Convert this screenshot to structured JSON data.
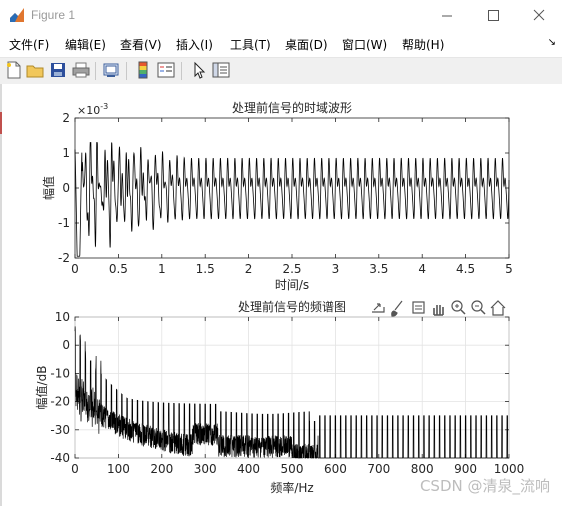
{
  "window": {
    "title": "Figure 1",
    "buttons": [
      "minimize",
      "maximize",
      "close"
    ]
  },
  "menu": {
    "items": [
      "文件(F)",
      "编辑(E)",
      "查看(V)",
      "插入(I)",
      "工具(T)",
      "桌面(D)",
      "窗口(W)",
      "帮助(H)"
    ],
    "expand": "↘"
  },
  "toolbar": {
    "icons": [
      "new-figure-icon",
      "open-file-icon",
      "save-icon",
      "print-icon",
      "link-plot-icon",
      "insert-colorbar-icon",
      "insert-legend-icon",
      "edit-plot-icon",
      "property-inspector-icon"
    ]
  },
  "axes_toolbar": {
    "icons": [
      "export-icon",
      "brush-icon",
      "data-tips-icon",
      "pan-icon",
      "zoom-in-icon",
      "zoom-out-icon",
      "home-icon"
    ]
  },
  "watermark": "CSDN @清泉_流响",
  "chart_data": [
    {
      "type": "line",
      "title": "处理前信号的时域波形",
      "xlabel": "时间/s",
      "ylabel": "幅值",
      "xlim": [
        0,
        5
      ],
      "ylim": [
        -2,
        2
      ],
      "exponent_label": "×10",
      "exponent_power": "-3",
      "xticks": [
        "0",
        "0.5",
        "1",
        "1.5",
        "2",
        "2.5",
        "3",
        "3.5",
        "4",
        "4.5",
        "5"
      ],
      "yticks": [
        "2",
        "1",
        "0",
        "-1",
        "-2"
      ],
      "grid": false,
      "series": [
        {
          "description_of_shape": null,
          "oscillation_cycles": 60,
          "steady_amplitude": 1.0
        }
      ]
    },
    {
      "type": "line",
      "title": "处理前信号的频谱图",
      "xlabel": "频率/Hz",
      "ylabel": "幅值/dB",
      "xlim": [
        0,
        1000
      ],
      "ylim": [
        -40,
        10
      ],
      "xticks": [
        "0",
        "100",
        "200",
        "300",
        "400",
        "500",
        "600",
        "700",
        "800",
        "900",
        "1000"
      ],
      "yticks": [
        "10",
        "0",
        "-10",
        "-20",
        "-30",
        "-40"
      ],
      "grid": true,
      "series": [
        {
          "harmonic_spacing_hz": 12
        }
      ]
    }
  ]
}
